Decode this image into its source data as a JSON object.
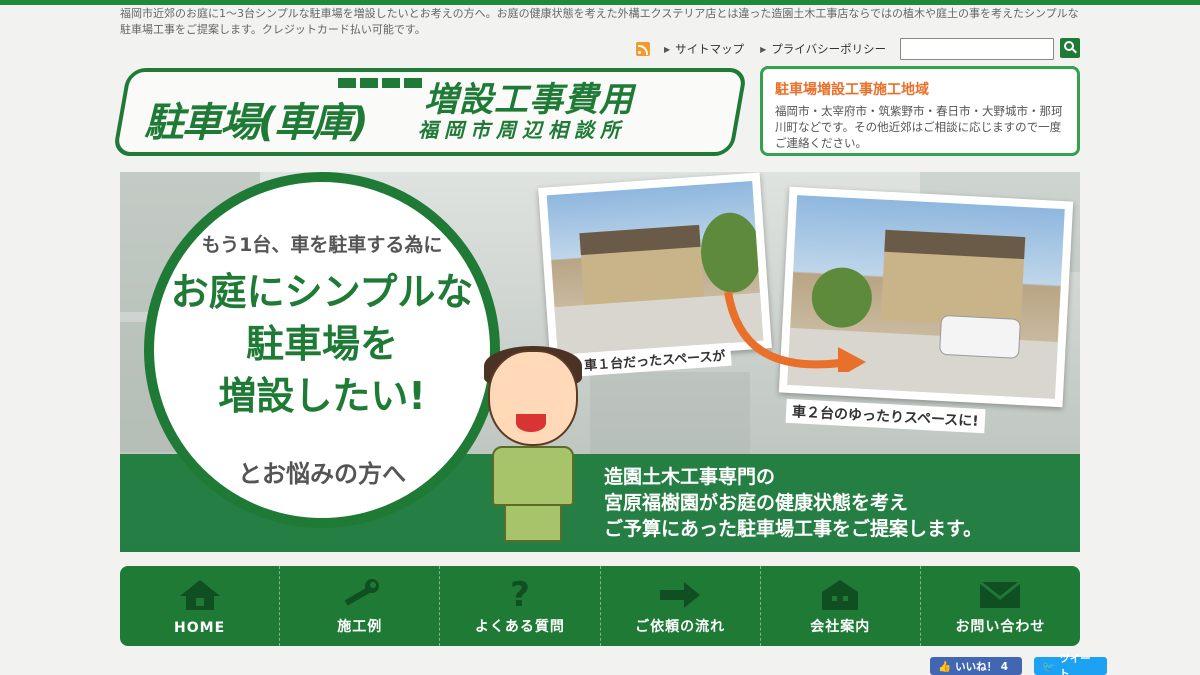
{
  "intro_text": "福岡市近郊のお庭に1〜3台シンプルな駐車場を増設したいとお考えの方へ。お庭の健康状態を考えた外構エクステリア店とは違った造園土木工事店ならではの植木や庭土の事を考えたシンプルな駐車場工事をご提案します。クレジットカード払い可能です。",
  "util": {
    "sitemap": "サイトマップ",
    "privacy": "プライバシーポリシー",
    "search_placeholder": ""
  },
  "logo": {
    "main": "駐車場(車庫)",
    "line1": "増設工事費用",
    "line2": "福岡市周辺相談所"
  },
  "area": {
    "title": "駐車場増設工事施工地域",
    "text": "福岡市・太宰府市・筑紫野市・春日市・大野城市・那珂川町などです。その他近郊はご相談に応じますので一度ご連絡ください。"
  },
  "hero": {
    "lead": "もう1台、車を駐車する為に",
    "headline1": "お庭にシンプルな",
    "headline2": "駐車場を",
    "headline3": "増設したい!",
    "tail": "とお悩みの方へ",
    "photo1_caption": "車１台だったスペースが",
    "photo2_caption": "車２台のゆったりスペースに!",
    "band_line1": "造園土木工事専門の",
    "band_line2": "宮原福樹園がお庭の健康状態を考え",
    "band_line3": "ご予算にあった駐車場工事をご提案します。"
  },
  "nav": [
    {
      "label": "HOME",
      "icon": "home-icon"
    },
    {
      "label": "施工例",
      "icon": "wrench-icon"
    },
    {
      "label": "よくある質問",
      "icon": "question-icon"
    },
    {
      "label": "ご依頼の流れ",
      "icon": "arrow-right-icon"
    },
    {
      "label": "会社案内",
      "icon": "building-icon"
    },
    {
      "label": "お問い合わせ",
      "icon": "mail-icon"
    }
  ],
  "social": {
    "like": "いいね！ 4",
    "tweet": "ツイート"
  },
  "colors": {
    "brand_green": "#1f7a36",
    "accent_orange": "#e8702a"
  }
}
